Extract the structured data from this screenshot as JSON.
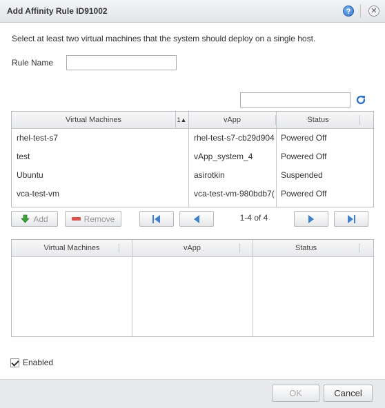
{
  "dialog": {
    "title": "Add Affinity Rule ID91002",
    "help_icon": "help-icon",
    "close_icon": "close-icon"
  },
  "instruction": "Select at least two virtual machines that the system should deploy on a single host.",
  "rule_name": {
    "label": "Rule Name",
    "value": ""
  },
  "filter": {
    "value": "",
    "refresh_icon": "refresh-icon"
  },
  "available_grid": {
    "columns": [
      "Virtual Machines",
      "vApp",
      "Status"
    ],
    "sort_indicator": "1▲",
    "rows": [
      {
        "vm": "rhel-test-s7",
        "vapp": "rhel-test-s7-cb29d904",
        "status": "Powered Off"
      },
      {
        "vm": "test",
        "vapp": "vApp_system_4",
        "status": "Powered Off"
      },
      {
        "vm": "Ubuntu",
        "vapp": "asirotkin",
        "status": "Suspended"
      },
      {
        "vm": "vca-test-vm",
        "vapp": "vca-test-vm-980bdb7(",
        "status": "Powered Off"
      }
    ]
  },
  "actions": {
    "add_label": "Add",
    "remove_label": "Remove"
  },
  "pager": {
    "info": "1-4 of 4"
  },
  "selected_grid": {
    "columns": [
      "Virtual Machines",
      "vApp",
      "Status"
    ],
    "rows": []
  },
  "enabled": {
    "label": "Enabled",
    "checked": true
  },
  "footer": {
    "ok_label": "OK",
    "cancel_label": "Cancel"
  },
  "colors": {
    "accent": "#2f72c8",
    "add_icon": "#3aa037",
    "remove_icon": "#d9534f"
  }
}
